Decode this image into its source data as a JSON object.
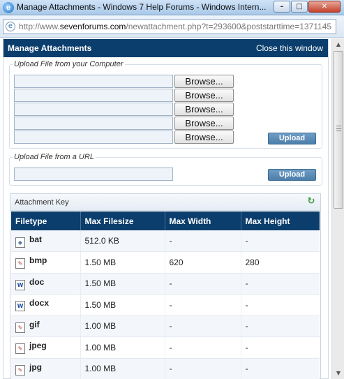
{
  "window": {
    "title": "Manage Attachments - Windows 7 Help Forums - Windows Intern...",
    "minimize_icon": "minimize-icon",
    "maximize_icon": "maximize-icon",
    "close_icon": "close-icon"
  },
  "address_bar": {
    "prefix": "http://www.",
    "domain": "sevenforums.com",
    "path": "/newattachment.php?t=293600&poststarttime=1371145"
  },
  "popup": {
    "title": "Manage Attachments",
    "close_link": "Close this window"
  },
  "upload_computer": {
    "legend": "Upload File from your Computer",
    "file_fields": [
      "",
      "",
      "",
      "",
      ""
    ],
    "browse_label": "Browse...",
    "upload_label": "Upload"
  },
  "upload_url": {
    "legend": "Upload File from a URL",
    "url_value": "",
    "upload_label": "Upload"
  },
  "attachment_key": {
    "title": "Attachment Key",
    "columns": [
      "Filetype",
      "Max Filesize",
      "Max Width",
      "Max Height"
    ],
    "rows": [
      {
        "icon": "generic-file-icon",
        "type": "bat",
        "size": "512.0 KB",
        "width": "-",
        "height": "-"
      },
      {
        "icon": "paint-image-icon",
        "type": "bmp",
        "size": "1.50 MB",
        "width": "620",
        "height": "280"
      },
      {
        "icon": "word-document-icon",
        "type": "doc",
        "size": "1.50 MB",
        "width": "-",
        "height": "-"
      },
      {
        "icon": "word-document-icon",
        "type": "docx",
        "size": "1.50 MB",
        "width": "-",
        "height": "-"
      },
      {
        "icon": "paint-image-icon",
        "type": "gif",
        "size": "1.00 MB",
        "width": "-",
        "height": "-"
      },
      {
        "icon": "paint-image-icon",
        "type": "jpeg",
        "size": "1.00 MB",
        "width": "-",
        "height": "-"
      },
      {
        "icon": "paint-image-icon",
        "type": "jpg",
        "size": "1.00 MB",
        "width": "-",
        "height": "-"
      }
    ]
  },
  "colors": {
    "header_bg": "#0b3e6d",
    "upload_button": "#5a8ab5",
    "row_alt": "#f3f7fb"
  }
}
